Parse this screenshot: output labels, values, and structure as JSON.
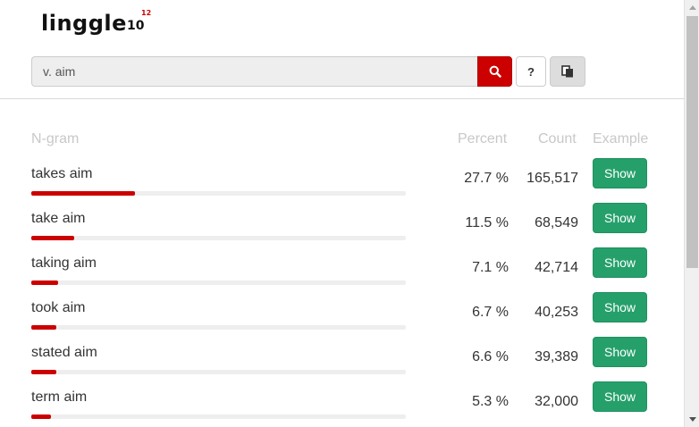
{
  "app": {
    "logo_text": "linggle",
    "logo_ten": "10",
    "logo_exponent": "12"
  },
  "search": {
    "value": "v. aim",
    "placeholder": ""
  },
  "icons": {
    "search": "search-icon",
    "help": "question-icon",
    "copy": "clipboard-icon",
    "scroll_up": "arrow-up-icon",
    "scroll_down": "arrow-down-icon"
  },
  "buttons": {
    "help_label": "?"
  },
  "table": {
    "headers": {
      "ngram": "N-gram",
      "percent": "Percent",
      "count": "Count",
      "example": "Example"
    },
    "rows": [
      {
        "ngram": "takes aim",
        "percent": "27.7 %",
        "count": "165,517",
        "fraction": 0.277,
        "example_label": "Show"
      },
      {
        "ngram": "take aim",
        "percent": "11.5 %",
        "count": "68,549",
        "fraction": 0.115,
        "example_label": "Show"
      },
      {
        "ngram": "taking aim",
        "percent": "7.1 %",
        "count": "42,714",
        "fraction": 0.071,
        "example_label": "Show"
      },
      {
        "ngram": "took aim",
        "percent": "6.7 %",
        "count": "40,253",
        "fraction": 0.067,
        "example_label": "Show"
      },
      {
        "ngram": "stated aim",
        "percent": "6.6 %",
        "count": "39,389",
        "fraction": 0.066,
        "example_label": "Show"
      },
      {
        "ngram": "term aim",
        "percent": "5.3 %",
        "count": "32,000",
        "fraction": 0.053,
        "example_label": "Show"
      }
    ]
  },
  "colors": {
    "accent": "#cc0000",
    "show_button": "#26a06b",
    "header_text": "#c8c8c8"
  }
}
